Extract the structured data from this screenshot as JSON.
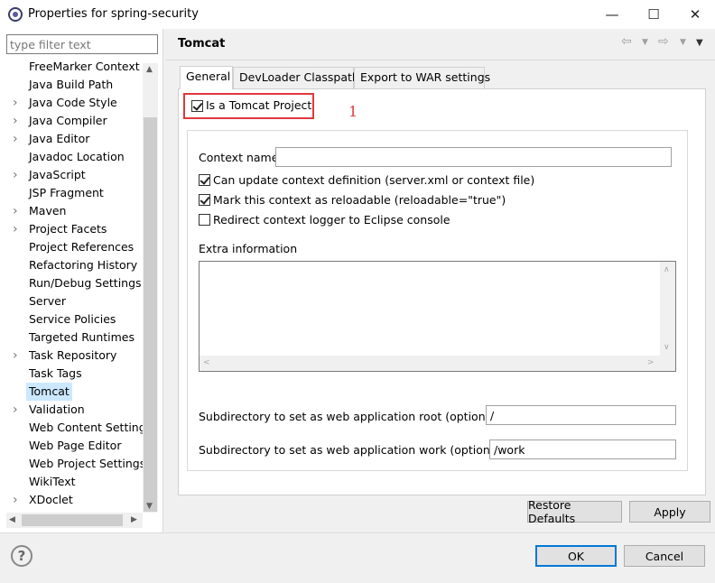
{
  "window": {
    "title": "Properties for spring-security",
    "minimize_glyph": "—",
    "maximize_glyph": "☐",
    "close_glyph": "✕"
  },
  "sidebar": {
    "filter_placeholder": "type filter text",
    "items": [
      {
        "label": "FreeMarker Context",
        "expandable": false
      },
      {
        "label": "Java Build Path",
        "expandable": false
      },
      {
        "label": "Java Code Style",
        "expandable": true
      },
      {
        "label": "Java Compiler",
        "expandable": true
      },
      {
        "label": "Java Editor",
        "expandable": true
      },
      {
        "label": "Javadoc Location",
        "expandable": false
      },
      {
        "label": "JavaScript",
        "expandable": true
      },
      {
        "label": "JSP Fragment",
        "expandable": false
      },
      {
        "label": "Maven",
        "expandable": true
      },
      {
        "label": "Project Facets",
        "expandable": true
      },
      {
        "label": "Project References",
        "expandable": false
      },
      {
        "label": "Refactoring History",
        "expandable": false
      },
      {
        "label": "Run/Debug Settings",
        "expandable": false
      },
      {
        "label": "Server",
        "expandable": false
      },
      {
        "label": "Service Policies",
        "expandable": false
      },
      {
        "label": "Targeted Runtimes",
        "expandable": false
      },
      {
        "label": "Task Repository",
        "expandable": true
      },
      {
        "label": "Task Tags",
        "expandable": false
      },
      {
        "label": "Tomcat",
        "expandable": false,
        "selected": true
      },
      {
        "label": "Validation",
        "expandable": true
      },
      {
        "label": "Web Content Settings",
        "expandable": false
      },
      {
        "label": "Web Page Editor",
        "expandable": false
      },
      {
        "label": "Web Project Settings",
        "expandable": false
      },
      {
        "label": "WikiText",
        "expandable": false
      },
      {
        "label": "XDoclet",
        "expandable": true
      }
    ]
  },
  "header": {
    "title": "Tomcat",
    "back_icon": "back-arrow-icon",
    "forward_icon": "forward-arrow-icon",
    "menu_icon": "dropdown-menu-icon"
  },
  "tabs": [
    {
      "label": "General",
      "active": true
    },
    {
      "label": "DevLoader Classpath",
      "active": false
    },
    {
      "label": "Export to WAR settings",
      "active": false
    }
  ],
  "general": {
    "is_tomcat_project_label": "Is a Tomcat Project",
    "is_tomcat_project_checked": true,
    "annotation_number": "1",
    "context_name_label": "Context name",
    "context_name_value": "",
    "options": [
      {
        "label": "Can update context definition (server.xml or context file)",
        "checked": true
      },
      {
        "label": "Mark this context as reloadable (reloadable=\"true\")",
        "checked": true
      },
      {
        "label": "Redirect context logger to Eclipse console",
        "checked": false
      }
    ],
    "extra_info_label": "Extra information",
    "extra_info_value": "",
    "webapp_root_label": "Subdirectory to set as web application root (optional)",
    "webapp_root_value": "/",
    "work_dir_label": "Subdirectory to set as web application work (optional)",
    "work_dir_value": "/work"
  },
  "buttons": {
    "restore_defaults": "Restore Defaults",
    "apply": "Apply",
    "ok": "OK",
    "cancel": "Cancel"
  },
  "colors": {
    "accent": "#0078d7",
    "annotation": "#e0383e",
    "selection": "#cce8ff"
  }
}
